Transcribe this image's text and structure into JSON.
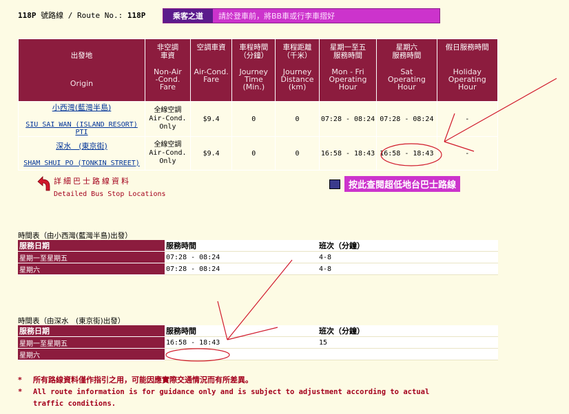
{
  "route": {
    "number_prefix": "118P",
    "label_zh": "號路線",
    "label_en": "Route No.:",
    "number": "118P"
  },
  "banner": {
    "tag": "乘客之道",
    "message": "請於登車前，將BB車或行李車摺好"
  },
  "table": {
    "headers": [
      {
        "zh": "出發地",
        "en": "Origin"
      },
      {
        "zh": "非空調\n車資",
        "en": "Non-Air\n-Cond.\nFare"
      },
      {
        "zh": "空調車資",
        "en": "Air-Cond.\nFare"
      },
      {
        "zh": "車程時間\n（分鐘）",
        "en": "Journey\nTime\n(Min.)"
      },
      {
        "zh": "車程距離\n（千米）",
        "en": "Journey\nDistance\n(km)"
      },
      {
        "zh": "星期一至五\n服務時間",
        "en": "Mon - Fri\nOperating\nHour"
      },
      {
        "zh": "星期六\n服務時間",
        "en": "Sat\nOperating\nHour"
      },
      {
        "zh": "假日服務時間",
        "en": "Holiday\nOperating\nHour"
      }
    ],
    "rows": [
      {
        "origin_zh": "小西灣(藍灣半島)",
        "origin_en": "SIU SAI WAN (ISLAND RESORT) PTI",
        "non_ac_fare": "全線空調\nAir-Cond.\nOnly",
        "ac_fare": "$9.4",
        "time": "0",
        "distance": "0",
        "mon_fri": "07:28 - 08:24",
        "sat": "07:28 - 08:24",
        "holiday": "-"
      },
      {
        "origin_zh": "深水　(東京街)",
        "origin_en": "SHAM SHUI PO (TONKIN STREET)",
        "non_ac_fare": "全線空調\nAir-Cond.\nOnly",
        "ac_fare": "$9.4",
        "time": "0",
        "distance": "0",
        "mon_fri": "16:58 - 18:43",
        "sat": "16:58 - 18:43",
        "holiday": "-"
      }
    ]
  },
  "detail_link": {
    "zh": "詳細巴士路線資料",
    "en": "Detailed Bus Stop Locations"
  },
  "low_fare_button": "按此查閱超低地台巴士路線",
  "timetable1": {
    "title": "時間表（由小西灣(藍灣半島)出發）",
    "headers": [
      "服務日期",
      "服務時間",
      "班次（分鐘）"
    ],
    "rows": [
      [
        "星期一至星期五",
        "07:28 - 08:24",
        "4-8"
      ],
      [
        "星期六",
        "07:28 - 08:24",
        "4-8"
      ]
    ]
  },
  "timetable2": {
    "title": "時間表（由深水　(東京街)出發）",
    "headers": [
      "服務日期",
      "服務時間",
      "班次（分鐘）"
    ],
    "rows": [
      [
        "星期一至星期五",
        "16:58 - 18:43",
        "15"
      ],
      [
        "星期六",
        "",
        ""
      ]
    ]
  },
  "notes": {
    "mark": "*",
    "zh": "所有路線資料僅作指引之用，可能因應實際交通情況而有所差異。",
    "en_line1": "All route information is for guidance only and is subject to adjustment according to actual",
    "en_line2": "traffic conditions."
  },
  "colors": {
    "header_maroon": "#8c1c3e",
    "page_bg": "#fdfbe4",
    "annotation_red": "#d0192b",
    "banner": "#cc33cc"
  }
}
